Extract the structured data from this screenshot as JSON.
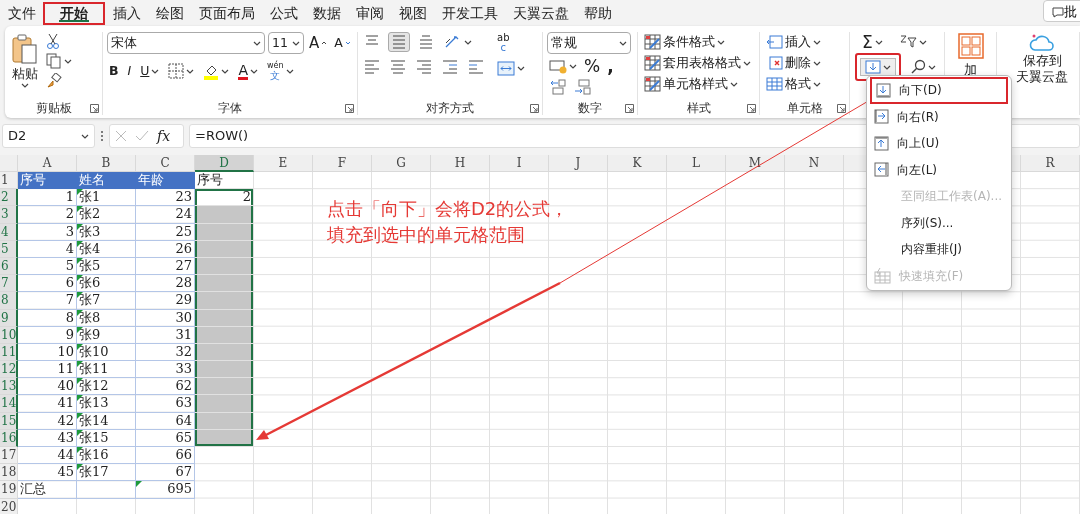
{
  "menu_tabs": [
    {
      "label": "文件",
      "selected": false,
      "highlighted": false
    },
    {
      "label": "开始",
      "selected": true,
      "highlighted": true
    },
    {
      "label": "插入",
      "selected": false,
      "highlighted": false
    },
    {
      "label": "绘图",
      "selected": false,
      "highlighted": false
    },
    {
      "label": "页面布局",
      "selected": false,
      "highlighted": false
    },
    {
      "label": "公式",
      "selected": false,
      "highlighted": false
    },
    {
      "label": "数据",
      "selected": false,
      "highlighted": false
    },
    {
      "label": "审阅",
      "selected": false,
      "highlighted": false
    },
    {
      "label": "视图",
      "selected": false,
      "highlighted": false
    },
    {
      "label": "开发工具",
      "selected": false,
      "highlighted": false
    },
    {
      "label": "天翼云盘",
      "selected": false,
      "highlighted": false
    },
    {
      "label": "帮助",
      "selected": false,
      "highlighted": false
    }
  ],
  "comment_button": {
    "label": "批"
  },
  "clipboard": {
    "paste": "粘贴",
    "group": "剪贴板"
  },
  "font": {
    "name": "宋体",
    "size": "11",
    "grow": "A",
    "shrink": "A",
    "bold": "B",
    "italic": "I",
    "underline": "U",
    "font_color": "A",
    "phonetic_top": "wén",
    "phonetic_bottom": "文",
    "group": "字体"
  },
  "alignment": {
    "wrap_top": "ab",
    "wrap_bottom": "c",
    "group": "对齐方式"
  },
  "number": {
    "format": "常规",
    "percent": "%",
    "comma": ",",
    "group": "数字"
  },
  "styles": {
    "items": [
      "条件格式",
      "套用表格格式",
      "单元格样式"
    ],
    "group": "样式"
  },
  "cells": {
    "items": [
      "插入",
      "删除",
      "格式"
    ],
    "group": "单元格"
  },
  "editing": {
    "sum": "Σ",
    "fill_highlighted": true
  },
  "addins": {
    "label": "加"
  },
  "cloud": {
    "lines": [
      "保存到",
      "天翼云盘"
    ]
  },
  "formula_bar": {
    "name_box": "D2",
    "fx": "fx",
    "formula": "=ROW()"
  },
  "sheet": {
    "columns": [
      {
        "label": "A",
        "selected": false
      },
      {
        "label": "B",
        "selected": false
      },
      {
        "label": "C",
        "selected": false
      },
      {
        "label": "D",
        "selected": true
      },
      {
        "label": "E",
        "selected": false
      },
      {
        "label": "F",
        "selected": false
      },
      {
        "label": "G",
        "selected": false
      },
      {
        "label": "H",
        "selected": false
      },
      {
        "label": "I",
        "selected": false
      },
      {
        "label": "J",
        "selected": false
      },
      {
        "label": "K",
        "selected": false
      },
      {
        "label": "L",
        "selected": false
      },
      {
        "label": "M",
        "selected": false
      },
      {
        "label": "N",
        "selected": false
      },
      {
        "label": "R",
        "selected": false
      }
    ],
    "rows": [
      {
        "label": "1",
        "kind": "header",
        "selected": false,
        "cells": {
          "A": "序号",
          "B": "姓名",
          "C": "年龄",
          "D": "序号"
        }
      },
      {
        "label": "2",
        "kind": "data",
        "selected": true,
        "cells": {
          "A": "1",
          "B": "张1",
          "C": "23",
          "D": "2"
        }
      },
      {
        "label": "3",
        "kind": "data",
        "selected": true,
        "cells": {
          "A": "2",
          "B": "张2",
          "C": "24"
        }
      },
      {
        "label": "4",
        "kind": "data",
        "selected": true,
        "cells": {
          "A": "3",
          "B": "张3",
          "C": "25"
        }
      },
      {
        "label": "5",
        "kind": "data",
        "selected": true,
        "cells": {
          "A": "4",
          "B": "张4",
          "C": "26"
        }
      },
      {
        "label": "6",
        "kind": "data",
        "selected": true,
        "cells": {
          "A": "5",
          "B": "张5",
          "C": "27"
        }
      },
      {
        "label": "7",
        "kind": "data",
        "selected": true,
        "cells": {
          "A": "6",
          "B": "张6",
          "C": "28"
        }
      },
      {
        "label": "8",
        "kind": "data",
        "selected": true,
        "cells": {
          "A": "7",
          "B": "张7",
          "C": "29"
        }
      },
      {
        "label": "9",
        "kind": "data",
        "selected": true,
        "cells": {
          "A": "8",
          "B": "张8",
          "C": "30"
        }
      },
      {
        "label": "10",
        "kind": "data",
        "selected": true,
        "cells": {
          "A": "9",
          "B": "张9",
          "C": "31"
        }
      },
      {
        "label": "11",
        "kind": "data",
        "selected": true,
        "cells": {
          "A": "10",
          "B": "张10",
          "C": "32"
        }
      },
      {
        "label": "12",
        "kind": "data",
        "selected": true,
        "cells": {
          "A": "11",
          "B": "张11",
          "C": "33"
        }
      },
      {
        "label": "13",
        "kind": "data",
        "selected": true,
        "cells": {
          "A": "40",
          "B": "张12",
          "C": "62"
        }
      },
      {
        "label": "14",
        "kind": "data",
        "selected": true,
        "cells": {
          "A": "41",
          "B": "张13",
          "C": "63"
        }
      },
      {
        "label": "15",
        "kind": "data",
        "selected": true,
        "cells": {
          "A": "42",
          "B": "张14",
          "C": "64"
        }
      },
      {
        "label": "16",
        "kind": "data",
        "selected": true,
        "cells": {
          "A": "43",
          "B": "张15",
          "C": "65"
        }
      },
      {
        "label": "17",
        "kind": "data",
        "selected": false,
        "cells": {
          "A": "44",
          "B": "张16",
          "C": "66"
        }
      },
      {
        "label": "18",
        "kind": "data",
        "selected": false,
        "cells": {
          "A": "45",
          "B": "张17",
          "C": "67"
        }
      },
      {
        "label": "19",
        "kind": "total",
        "selected": false,
        "cells": {
          "A": "汇总",
          "C": "695"
        }
      },
      {
        "label": "20",
        "kind": "empty",
        "selected": false,
        "cells": {}
      }
    ]
  },
  "annotation": {
    "lines": [
      "点击「向下」会将D2的公式，",
      "填充到选中的单元格范围"
    ]
  },
  "fill_menu": {
    "items": [
      {
        "label": "向下(D)",
        "kind": "down",
        "disabled": false,
        "highlighted": true
      },
      {
        "label": "向右(R)",
        "kind": "right",
        "disabled": false,
        "highlighted": false
      },
      {
        "label": "向上(U)",
        "kind": "up",
        "disabled": false,
        "highlighted": false
      },
      {
        "label": "向左(L)",
        "kind": "left",
        "disabled": false,
        "highlighted": false
      },
      {
        "label": "至同组工作表(A)...",
        "kind": "plain",
        "disabled": true,
        "highlighted": false
      },
      {
        "label": "序列(S)...",
        "kind": "plain",
        "disabled": false,
        "highlighted": false
      },
      {
        "label": "内容重排(J)",
        "kind": "plain",
        "disabled": false,
        "highlighted": false
      },
      {
        "label": "快速填充(F)",
        "kind": "flash",
        "disabled": true,
        "highlighted": false
      }
    ]
  }
}
